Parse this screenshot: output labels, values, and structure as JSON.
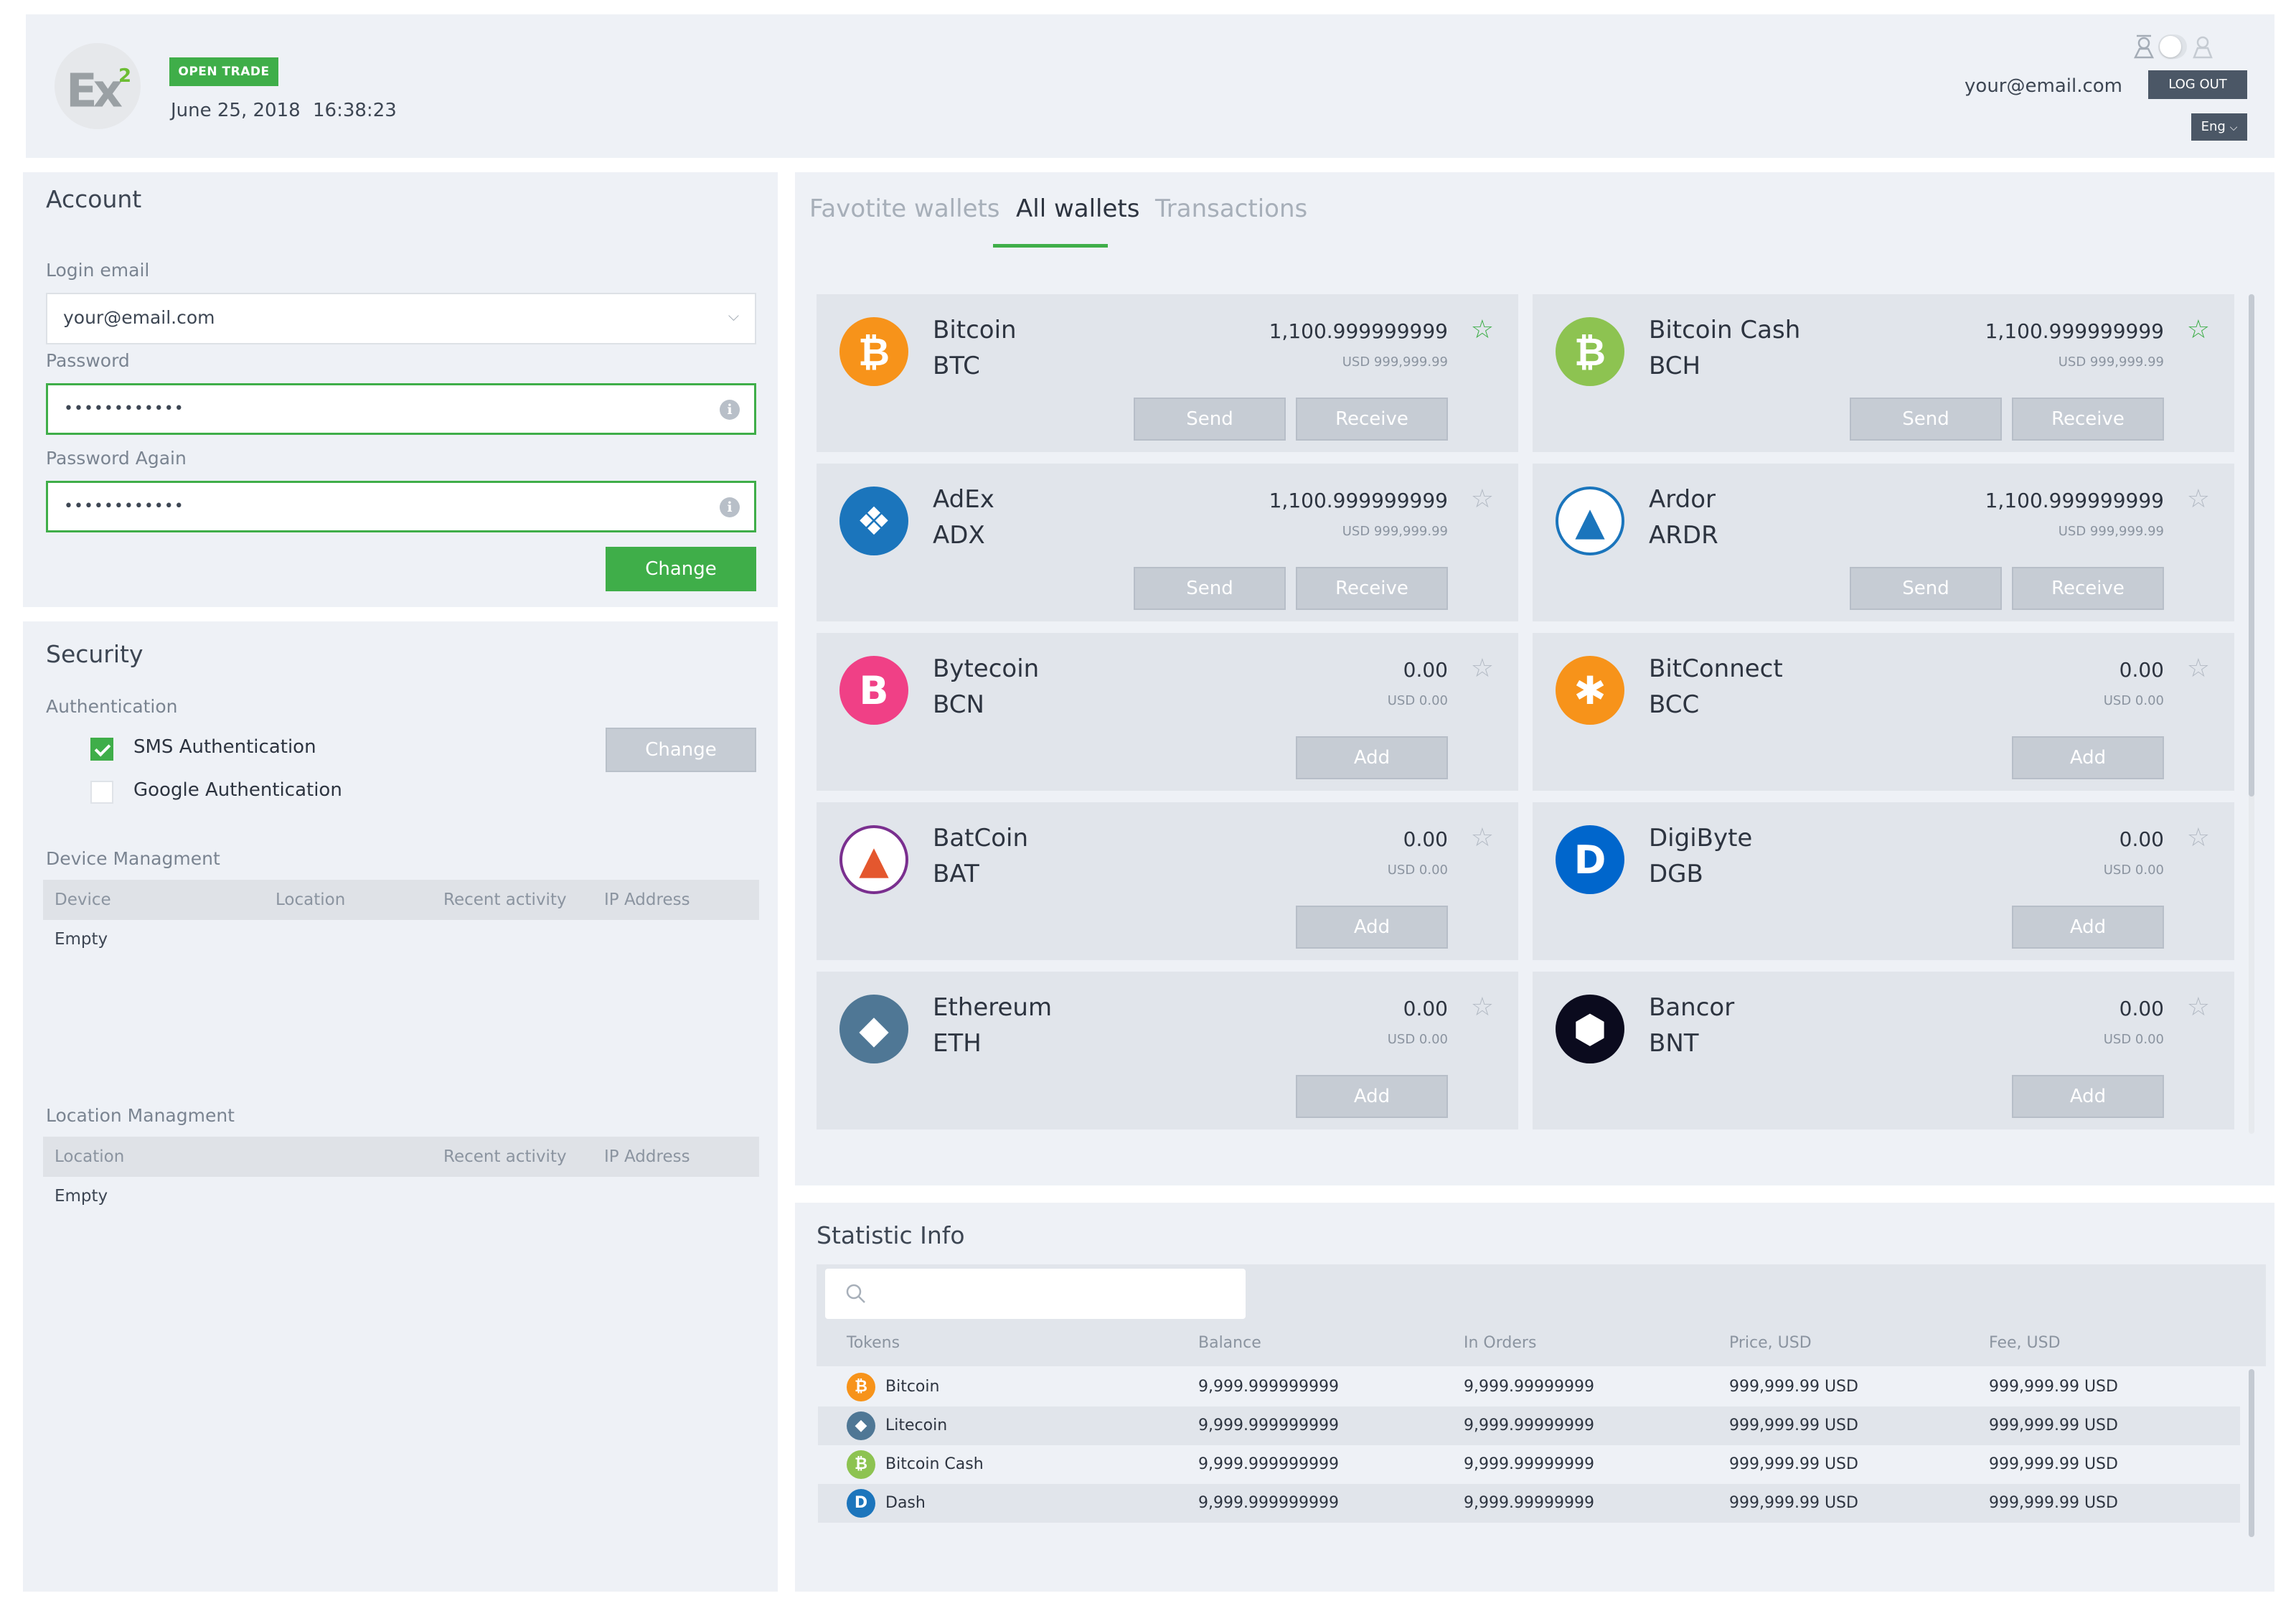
{
  "header": {
    "logo_text": "Ex",
    "logo_sup": "2",
    "badge": "OPEN TRADE",
    "date": "June 25, 2018",
    "time": "16:38:23",
    "user_email": "your@email.com",
    "logout_label": "LOG OUT",
    "language": "Eng"
  },
  "account": {
    "title": "Account",
    "login_email_label": "Login email",
    "login_email_value": "your@email.com",
    "password_label": "Password",
    "password_value": "••••••••••••",
    "password_again_label": "Password Again",
    "password_again_value": "••••••••••••",
    "change_label": "Change"
  },
  "security": {
    "title": "Security",
    "auth_label": "Authentication",
    "sms_label": "SMS Authentication",
    "sms_checked": true,
    "google_label": "Google Authentication",
    "google_checked": false,
    "change_label": "Change",
    "device_title": "Device Managment",
    "device_columns": [
      "Device",
      "Location",
      "Recent activity",
      "IP Address"
    ],
    "device_empty": "Empty",
    "location_title": "Location Managment",
    "location_columns": [
      "Location",
      "Recent activity",
      "IP Address"
    ],
    "location_empty": "Empty"
  },
  "wallets": {
    "tabs": [
      {
        "label": "Favotite wallets",
        "active": false
      },
      {
        "label": "All wallets",
        "active": true
      },
      {
        "label": "Transactions",
        "active": false
      }
    ],
    "send_label": "Send",
    "receive_label": "Receive",
    "add_label": "Add",
    "items": [
      {
        "name": "Bitcoin",
        "symbol": "BTC",
        "balance": "1,100.999999999",
        "usd": "USD 999,999.99",
        "favorite": true,
        "owned": true,
        "icon": "bitcoin-icon",
        "glyph": "₿",
        "color": "#f7931a"
      },
      {
        "name": "Bitcoin Cash",
        "symbol": "BCH",
        "balance": "1,100.999999999",
        "usd": "USD 999,999.99",
        "favorite": true,
        "owned": true,
        "icon": "bitcoin-cash-icon",
        "glyph": "₿",
        "color": "#8dc351"
      },
      {
        "name": "AdEx",
        "symbol": "ADX",
        "balance": "1,100.999999999",
        "usd": "USD 999,999.99",
        "favorite": false,
        "owned": true,
        "icon": "adex-icon",
        "glyph": "❖",
        "color": "#1b75bc"
      },
      {
        "name": "Ardor",
        "symbol": "ARDR",
        "balance": "1,100.999999999",
        "usd": "USD 999,999.99",
        "favorite": false,
        "owned": true,
        "icon": "ardor-icon",
        "glyph": "▲",
        "color": "#ffffff"
      },
      {
        "name": "Bytecoin",
        "symbol": "BCN",
        "balance": "0.00",
        "usd": "USD 0.00",
        "favorite": false,
        "owned": false,
        "icon": "bytecoin-icon",
        "glyph": "B",
        "color": "#f04086"
      },
      {
        "name": "BitConnect",
        "symbol": "BCC",
        "balance": "0.00",
        "usd": "USD 0.00",
        "favorite": false,
        "owned": false,
        "icon": "bitconnect-icon",
        "glyph": "✱",
        "color": "#f7931a"
      },
      {
        "name": "BatCoin",
        "symbol": "BAT",
        "balance": "0.00",
        "usd": "USD 0.00",
        "favorite": false,
        "owned": false,
        "icon": "batcoin-icon",
        "glyph": "▲",
        "color": "#ffffff"
      },
      {
        "name": "DigiByte",
        "symbol": "DGB",
        "balance": "0.00",
        "usd": "USD 0.00",
        "favorite": false,
        "owned": false,
        "icon": "digibyte-icon",
        "glyph": "D",
        "color": "#0066cc"
      },
      {
        "name": "Ethereum",
        "symbol": "ETH",
        "balance": "0.00",
        "usd": "USD 0.00",
        "favorite": false,
        "owned": false,
        "icon": "ethereum-icon",
        "glyph": "◆",
        "color": "#4f7795"
      },
      {
        "name": "Bancor",
        "symbol": "BNT",
        "balance": "0.00",
        "usd": "USD 0.00",
        "favorite": false,
        "owned": false,
        "icon": "bancor-icon",
        "glyph": "⬢",
        "color": "#0b0b1e"
      }
    ]
  },
  "statistic": {
    "title": "Statistic Info",
    "columns": [
      "Tokens",
      "Balance",
      "In Orders",
      "Price, USD",
      "Fee, USD"
    ],
    "rows": [
      {
        "token": "Bitcoin",
        "balance": "9,999.999999999",
        "in_orders": "9,999.99999999",
        "price": "999,999.99 USD",
        "fee": "999,999.99 USD",
        "icon": "bitcoin-icon",
        "glyph": "₿",
        "color": "#f7931a"
      },
      {
        "token": "Litecoin",
        "balance": "9,999.999999999",
        "in_orders": "9,999.99999999",
        "price": "999,999.99 USD",
        "fee": "999,999.99 USD",
        "icon": "litecoin-icon",
        "glyph": "◆",
        "color": "#4f7795"
      },
      {
        "token": "Bitcoin Cash",
        "balance": "9,999.999999999",
        "in_orders": "9,999.99999999",
        "price": "999,999.99 USD",
        "fee": "999,999.99 USD",
        "icon": "bitcoin-cash-icon",
        "glyph": "₿",
        "color": "#8dc351"
      },
      {
        "token": "Dash",
        "balance": "9,999.999999999",
        "in_orders": "9,999.99999999",
        "price": "999,999.99 USD",
        "fee": "999,999.99 USD",
        "icon": "dash-icon",
        "glyph": "D",
        "color": "#1c75bc"
      }
    ]
  }
}
